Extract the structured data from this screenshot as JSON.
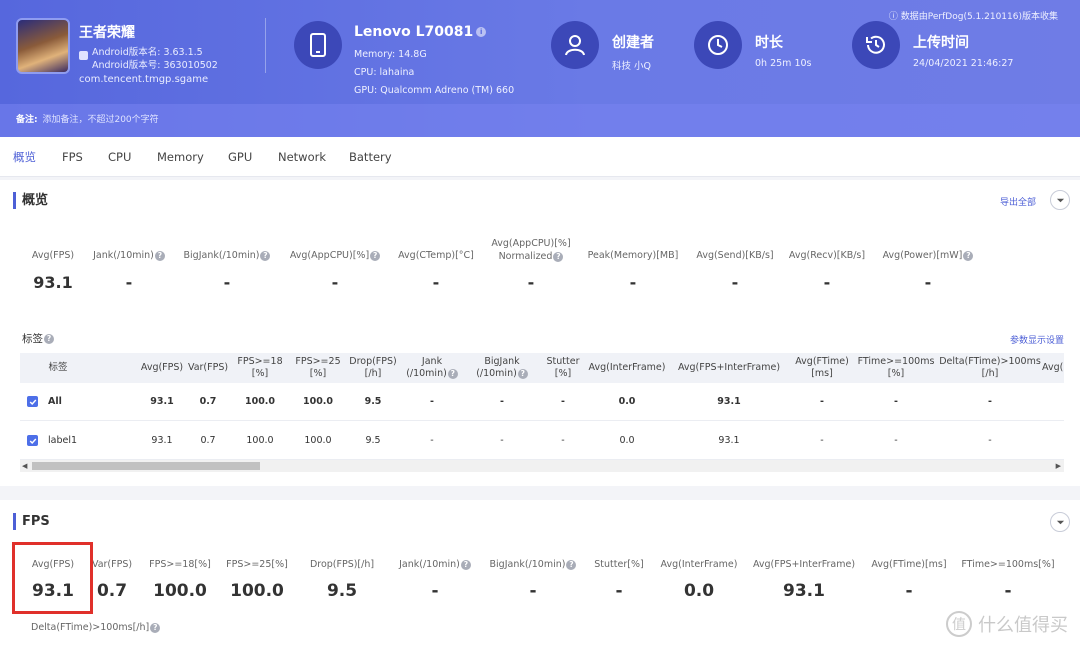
{
  "header": {
    "app": {
      "name": "王者荣耀",
      "version_name": "Android版本名: 3.63.1.5",
      "version_code": "Android版本号: 363010502",
      "package": "com.tencent.tmgp.sgame"
    },
    "device": {
      "model": "Lenovo L70081",
      "memory": "Memory: 14.8G",
      "cpu": "CPU: lahaina",
      "gpu": "GPU: Qualcomm Adreno (TM) 660"
    },
    "creator": {
      "title": "创建者",
      "value": "科技 小Q"
    },
    "duration": {
      "title": "时长",
      "value": "0h 25m 10s"
    },
    "upload": {
      "title": "上传时间",
      "value": "24/04/2021 21:46:27"
    },
    "source": "数据由PerfDog(5.1.210116)版本收集",
    "note_label": "备注:",
    "note_placeholder": "添加备注，不超过200个字符"
  },
  "tabs": [
    "概览",
    "FPS",
    "CPU",
    "Memory",
    "GPU",
    "Network",
    "Battery"
  ],
  "overview": {
    "title": "概览",
    "export": "导出全部",
    "metrics": [
      {
        "label": "Avg(FPS)",
        "value": "93.1"
      },
      {
        "label": "Jank(/10min)",
        "value": "-"
      },
      {
        "label": "BigJank(/10min)",
        "value": "-"
      },
      {
        "label": "Avg(AppCPU)[%]",
        "value": "-"
      },
      {
        "label": "Avg(CTemp)[°C]",
        "value": "-"
      },
      {
        "label": "Avg(AppCPU)[%]",
        "label2": "Normalized",
        "value": "-"
      },
      {
        "label": "Peak(Memory)[MB]",
        "value": "-"
      },
      {
        "label": "Avg(Send)[KB/s]",
        "value": "-"
      },
      {
        "label": "Avg(Recv)[KB/s]",
        "value": "-"
      },
      {
        "label": "Avg(Power)[mW]",
        "value": "-"
      }
    ]
  },
  "tags": {
    "title": "标签",
    "param_link": "参数显示设置",
    "headers": [
      [
        "标签"
      ],
      [
        "Avg(FPS)"
      ],
      [
        "Var(FPS)"
      ],
      [
        "FPS>=18",
        "[%]"
      ],
      [
        "FPS>=25",
        "[%]"
      ],
      [
        "Drop(FPS)",
        "[/h]"
      ],
      [
        "Jank",
        "(/10min)"
      ],
      [
        "BigJank",
        "(/10min)"
      ],
      [
        "Stutter",
        "[%]"
      ],
      [
        "Avg(InterFrame)"
      ],
      [
        "Avg(FPS+InterFrame)"
      ],
      [
        "Avg(FTime)",
        "[ms]"
      ],
      [
        "FTime>=100ms",
        "[%]"
      ],
      [
        "Delta(FTime)>100ms",
        "[/h]"
      ],
      [
        "Avg("
      ]
    ],
    "rows": [
      {
        "cells": [
          "All",
          "93.1",
          "0.7",
          "100.0",
          "100.0",
          "9.5",
          "-",
          "-",
          "-",
          "0.0",
          "93.1",
          "-",
          "-",
          "-"
        ]
      },
      {
        "cells": [
          "label1",
          "93.1",
          "0.7",
          "100.0",
          "100.0",
          "9.5",
          "-",
          "-",
          "-",
          "0.0",
          "93.1",
          "-",
          "-",
          "-"
        ]
      }
    ]
  },
  "fps": {
    "title": "FPS",
    "metrics": [
      {
        "label": "Avg(FPS)",
        "value": "93.1"
      },
      {
        "label": "Var(FPS)",
        "value": "0.7"
      },
      {
        "label": "FPS>=18[%]",
        "value": "100.0"
      },
      {
        "label": "FPS>=25[%]",
        "value": "100.0"
      },
      {
        "label": "Drop(FPS)[/h]",
        "value": "9.5"
      },
      {
        "label": "Jank(/10min)",
        "value": "-"
      },
      {
        "label": "BigJank(/10min)",
        "value": "-"
      },
      {
        "label": "Stutter[%]",
        "value": "-"
      },
      {
        "label": "Avg(InterFrame)",
        "value": "0.0"
      },
      {
        "label": "Avg(FPS+InterFrame)",
        "value": "93.1"
      },
      {
        "label": "Avg(FTime)[ms]",
        "value": "-"
      },
      {
        "label": "FTime>=100ms[%]",
        "value": "-"
      }
    ],
    "extra_label": "Delta(FTime)>100ms[/h]"
  },
  "watermark": "什么值得买",
  "colors": {
    "header": "#5667dd",
    "accent": "#4d5fd6",
    "highlight": "#e0302a"
  }
}
